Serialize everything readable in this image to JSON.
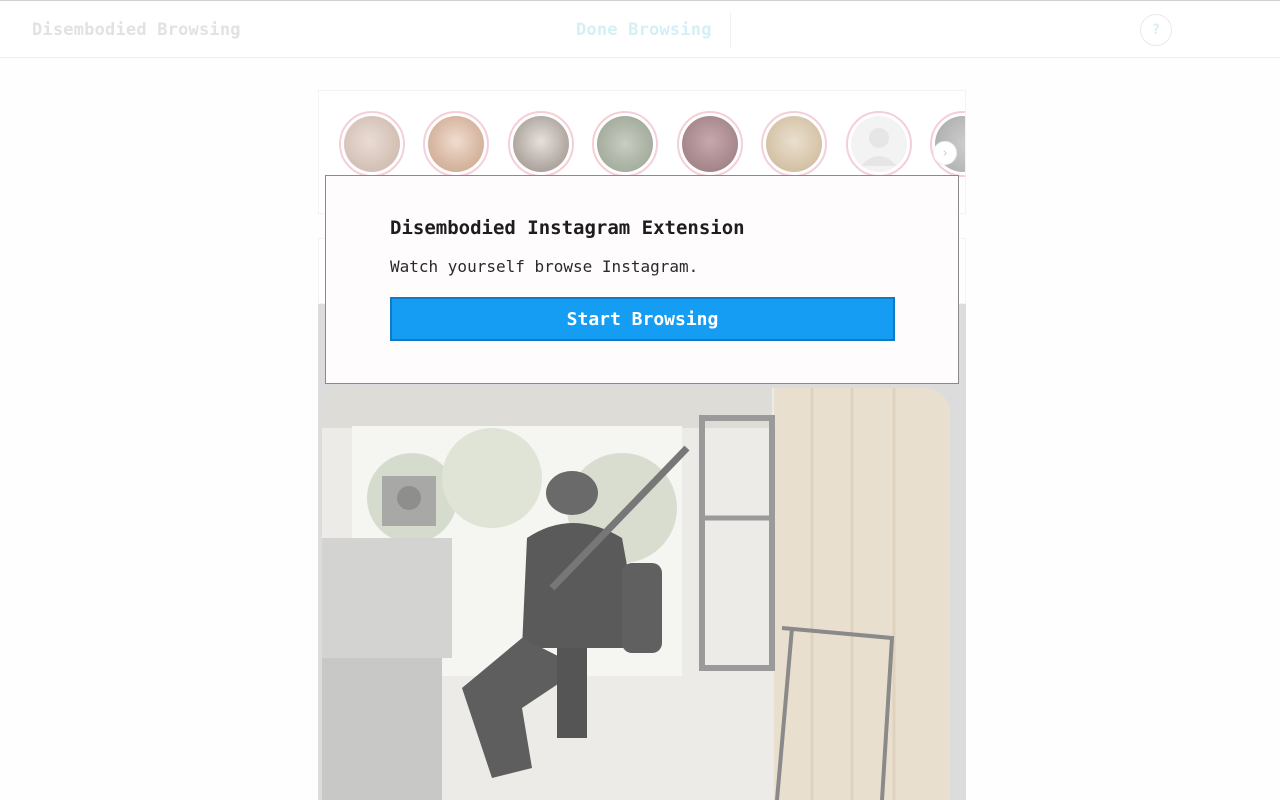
{
  "header": {
    "brand": "Disembodied Browsing",
    "done_label": "Done Browsing",
    "help_label": "?"
  },
  "stories": {
    "count_visible": 8,
    "arrow_icon": "chevron-right-icon"
  },
  "modal": {
    "title": "Disembodied Instagram Extension",
    "subtitle": "Watch yourself browse Instagram.",
    "button_label": "Start Browsing"
  },
  "colors": {
    "accent": "#159df4",
    "story_ring": "#f4cfd8"
  }
}
